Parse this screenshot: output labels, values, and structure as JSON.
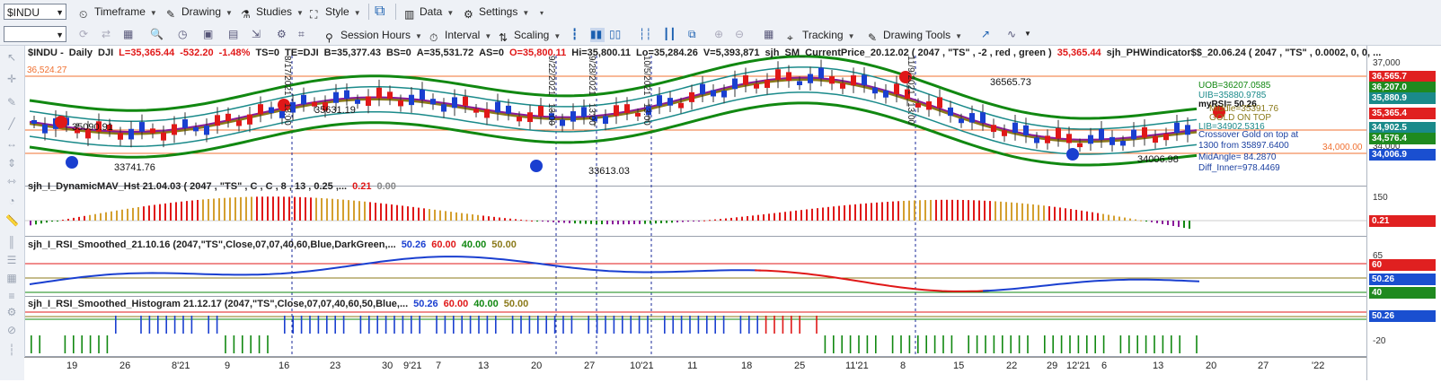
{
  "toolbar1": {
    "symbol": "$INDU",
    "items": [
      "Timeframe",
      "Drawing",
      "Studies",
      "Style",
      "Data",
      "Settings"
    ]
  },
  "toolbar2": {
    "items": [
      "Session Hours",
      "Interval",
      "Scaling",
      "Tracking",
      "Drawing Tools"
    ]
  },
  "main": {
    "symbol": "$INDU",
    "period": "Daily",
    "exchange": "DJI",
    "last": "L=35,365.44",
    "chg": "-532.20",
    "pct": "-1.48%",
    "ts": "TS=0",
    "te": "TE=DJI",
    "bid": "B=35,377.43",
    "bs": "BS=0",
    "ask": "A=35,531.72",
    "as": "AS=0",
    "open": "O=35,800.11",
    "hi": "Hi=35,800.11",
    "lo": "Lo=35,284.26",
    "vol": "V=5,393,871",
    "study1": "sjh_SM_CurrentPrice_20.12.02 ( 2047 , \"TS\" , -2 , red , green )",
    "study1_val": "35,365.44",
    "study2": "sjh_PHWindicator$$_20.06.24 ( 2047 ,   \"TS\" , 0.0002,    0,    0, ..."
  },
  "annotations": {
    "hline_left": "36,524.27",
    "price_left1": "35090.91",
    "price_left2": "33741.76",
    "price_mid1": "35631.19",
    "price_mid2": "33613.03",
    "price_top": "36565.73",
    "price_right": "34006.98",
    "hline_right": "34,000.00",
    "ub": "UOB=36207.0585",
    "uib": "UIB=35880.9785",
    "myrsi": "myRSI= 50.26",
    "middle": "Middle=35391.76",
    "gold": "GOLD ON TOP",
    "lib": "LIB=34902.5316",
    "cross1": "Crossover Gold on top at",
    "cross2": "1300 from 35897.6400",
    "mid_angle": "MidAngle= 84.2870",
    "diff_inner": "Diff_Inner=978.4469",
    "v1": "8/17/2021",
    "v1t": "13:00",
    "v2": "9/22/2021",
    "v2t": "13:00",
    "v3": "9/28/2021",
    "v3t": "13:00",
    "v4": "10/5/2021",
    "v4t": "13:00",
    "v5": "11/9/2021",
    "v5t": "13:00"
  },
  "price_axis": {
    "ticks": [
      "37,000",
      "34,000"
    ],
    "tags": [
      {
        "text": "36,565.7",
        "color": "#e02020"
      },
      {
        "text": "36,207.0",
        "color": "#1f8a1f"
      },
      {
        "text": "35,880.9",
        "color": "#1a8a8a"
      },
      {
        "text": "35,365.4",
        "color": "#e02020"
      },
      {
        "text": "34,902.5",
        "color": "#1a8a8a"
      },
      {
        "text": "34,576.4",
        "color": "#1f8a1f"
      },
      {
        "text": "34,006.9",
        "color": "#1a4fd0"
      }
    ]
  },
  "panel2": {
    "title": "sjh_I_DynamicMAV_Hst 21.04.03 ( 2047 , \"TS\" , C , C ,  8 , 13 , 0.25 ,...",
    "v1": "0.21",
    "v2": "0.00",
    "axis": "150",
    "tag": "0.21"
  },
  "panel3": {
    "title": "sjh_I_RSI_Smoothed_21.10.16 (2047,\"TS\",Close,07,07,40,60,Blue,DarkGreen,...",
    "v1": "50.26",
    "v2": "60.00",
    "v3": "40.00",
    "v4": "50.00",
    "axis": "65",
    "tags": [
      "60",
      "50.26",
      "40"
    ]
  },
  "panel4": {
    "title": "sjh_I_RSI_Smoothed_Histogram 21.12.17 (2047,\"TS\",Close,07,07,40,60,50,Blue,...",
    "v1": "50.26",
    "v2": "60.00",
    "v3": "40.00",
    "v4": "50.00",
    "tag": "50.26",
    "axis": "-20"
  },
  "xaxis": [
    "19",
    "26",
    "8'21",
    "9",
    "16",
    "23",
    "30",
    "9'21",
    "7",
    "13",
    "20",
    "27",
    "10'21",
    "11",
    "18",
    "25",
    "11'21",
    "8",
    "15",
    "22",
    "29",
    "12'21",
    "6",
    "13",
    "20",
    "27",
    "'22"
  ],
  "colors": {
    "up": "#1a3fd0",
    "down": "#e01818",
    "gold": "#8b7a1a",
    "green": "#118811",
    "teal": "#1a8a8a",
    "purple": "#8a1a9a",
    "orange": "#f07030"
  }
}
